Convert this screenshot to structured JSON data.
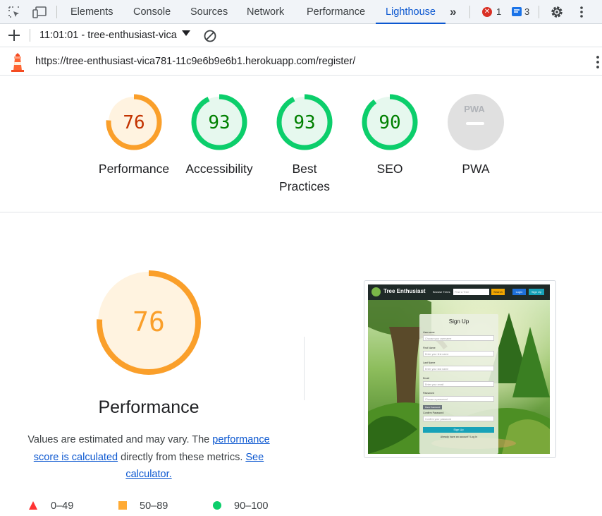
{
  "devtools": {
    "tabs": [
      {
        "label": "Elements"
      },
      {
        "label": "Console"
      },
      {
        "label": "Sources"
      },
      {
        "label": "Network"
      },
      {
        "label": "Performance"
      },
      {
        "label": "Lighthouse"
      }
    ],
    "active_tab": "Lighthouse",
    "error_count": "1",
    "message_count": "3",
    "colors": {
      "accent": "#0b57d0",
      "error": "#d93025",
      "message": "#1a73e8"
    }
  },
  "report_bar": {
    "report_selector": "11:01:01 - tree-enthusiast-vica",
    "url": "https://tree-enthusiast-vica781-11c9e6b9e6b1.herokuapp.com/register/"
  },
  "scores": [
    {
      "value": "76",
      "label": "Performance",
      "label_line2": "",
      "color": "#fa9f2a",
      "text_color": "#c33300",
      "bg": "#fff3e0",
      "fraction": 0.76
    },
    {
      "value": "93",
      "label": "Accessibility",
      "label_line2": "",
      "color": "#0cce6b",
      "text_color": "#008000",
      "bg": "#e6f8ee",
      "fraction": 0.93
    },
    {
      "value": "93",
      "label": "Best",
      "label_line2": "Practices",
      "color": "#0cce6b",
      "text_color": "#008000",
      "bg": "#e6f8ee",
      "fraction": 0.93
    },
    {
      "value": "90",
      "label": "SEO",
      "label_line2": "",
      "color": "#0cce6b",
      "text_color": "#008000",
      "bg": "#e6f8ee",
      "fraction": 0.9
    },
    {
      "value": "",
      "label": "PWA",
      "label_line2": "",
      "color": "#dadce0",
      "text_color": "#9aa0a6",
      "bg": "#e0e0e0",
      "fraction": 0,
      "pwa_text": "PWA"
    }
  ],
  "detail": {
    "score": "76",
    "fraction": 0.76,
    "title": "Performance",
    "desc_text_1": "Values are estimated and may vary. The ",
    "desc_link_1": "performance score is calculated",
    "desc_text_2": " directly from these metrics. ",
    "desc_link_2": "See calculator.",
    "legend": [
      {
        "range": "0–49",
        "shape": "triangle",
        "color": "#ff3333"
      },
      {
        "range": "50–89",
        "shape": "square",
        "color": "#ffaa33"
      },
      {
        "range": "90–100",
        "shape": "circle",
        "color": "#0cce6b"
      }
    ]
  },
  "screenshot": {
    "site_name": "Tree Enthusiast",
    "browse_label": "Browse Trees",
    "search_placeholder": "Find a Tree",
    "search_button": "Search",
    "login_button": "Login",
    "signup_button": "Sign Up",
    "form_title": "Sign Up",
    "fields": [
      {
        "label": "Username",
        "placeholder": "Choose your username"
      },
      {
        "label": "First Name",
        "placeholder": "Enter your first name"
      },
      {
        "label": "Last Name",
        "placeholder": "Enter your last name"
      },
      {
        "label": "Email",
        "placeholder": "Enter your email"
      },
      {
        "label": "Password",
        "placeholder": "Choose a password"
      },
      {
        "label": "Confirm Password",
        "placeholder": "Confirm your password"
      }
    ],
    "show_password": "Show Password",
    "submit": "Sign Up",
    "footer_text": "Already have an account?",
    "footer_link": "Log In"
  }
}
